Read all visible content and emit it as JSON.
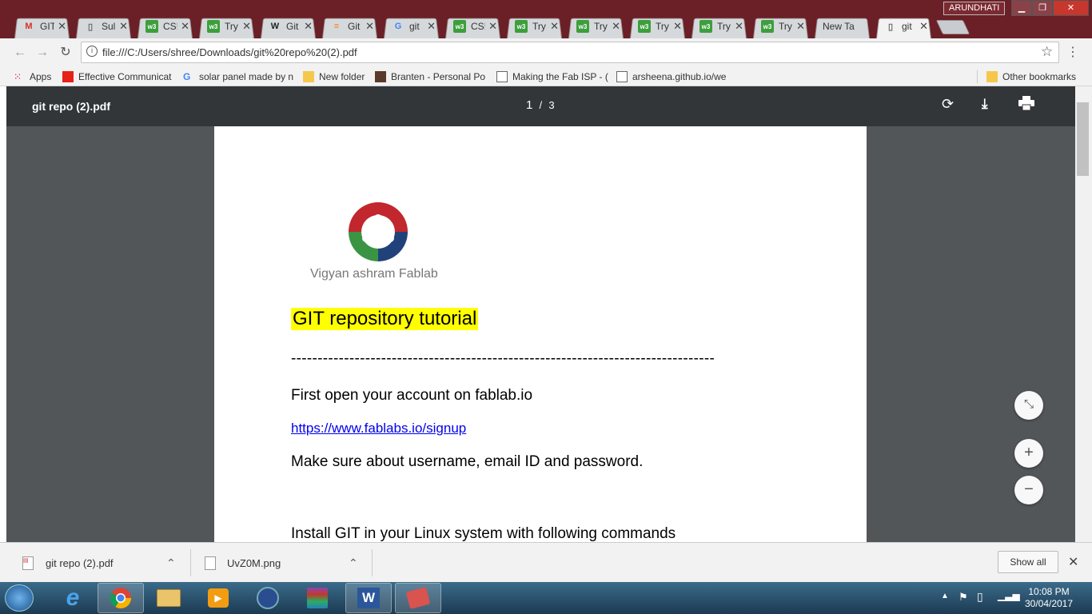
{
  "browser": {
    "profile_name": "ARUNDHATI",
    "tabs": [
      {
        "label": "GIT",
        "icon": "gmail-icon"
      },
      {
        "label": "Sul",
        "icon": "page-icon"
      },
      {
        "label": "CS!",
        "icon": "w3-icon"
      },
      {
        "label": "Try",
        "icon": "w3-icon"
      },
      {
        "label": "Git",
        "icon": "wikipedia-icon"
      },
      {
        "label": "Git",
        "icon": "stackoverflow-icon"
      },
      {
        "label": "git",
        "icon": "google-icon"
      },
      {
        "label": "CS!",
        "icon": "w3-icon"
      },
      {
        "label": "Try",
        "icon": "w3-icon"
      },
      {
        "label": "Try",
        "icon": "w3-icon"
      },
      {
        "label": "Try",
        "icon": "w3-icon"
      },
      {
        "label": "Try",
        "icon": "w3-icon"
      },
      {
        "label": "Try",
        "icon": "w3-icon"
      },
      {
        "label": "New Ta",
        "icon": ""
      },
      {
        "label": "git",
        "icon": "page-icon",
        "active": true
      }
    ],
    "url": "file:///C:/Users/shree/Downloads/git%20repo%20(2).pdf",
    "bookmarks": [
      {
        "label": "Apps",
        "icon": "apps-icon"
      },
      {
        "label": "Effective Communicat",
        "icon": "youtube-icon"
      },
      {
        "label": "solar panel made by n",
        "icon": "google-icon"
      },
      {
        "label": "New folder",
        "icon": "folder-icon"
      },
      {
        "label": "Branten - Personal Po",
        "icon": "photo-icon"
      },
      {
        "label": "Making the Fab ISP - (",
        "icon": "page-icon"
      },
      {
        "label": "arsheena.github.io/we",
        "icon": "page-icon"
      }
    ],
    "other_bookmarks": "Other bookmarks"
  },
  "pdf": {
    "filename": "git repo (2).pdf",
    "current_page": "1",
    "separator": "/",
    "total_pages": "3",
    "logo_text": "Vigyan ashram Fablab",
    "heading": "GIT repository tutorial",
    "rule": "--------------------------------------------------------------------------------",
    "line1": "First open your account on fablab.io",
    "link": "https://www.fablabs.io/signup",
    "line2": "Make sure about username, email ID and password.",
    "line3": "Install GIT in your Linux system with following commands"
  },
  "downloads": {
    "items": [
      {
        "name": "git repo (2).pdf"
      },
      {
        "name": "UvZ0M.png"
      }
    ],
    "show_all": "Show all"
  },
  "taskbar": {
    "time": "10:08 PM",
    "date": "30/04/2017"
  },
  "colors": {
    "title_bar": "#6b1f26",
    "pdf_toolbar": "#323639",
    "pdf_background": "#525659",
    "heading_highlight": "#ffff00",
    "link": "#0000ee"
  }
}
